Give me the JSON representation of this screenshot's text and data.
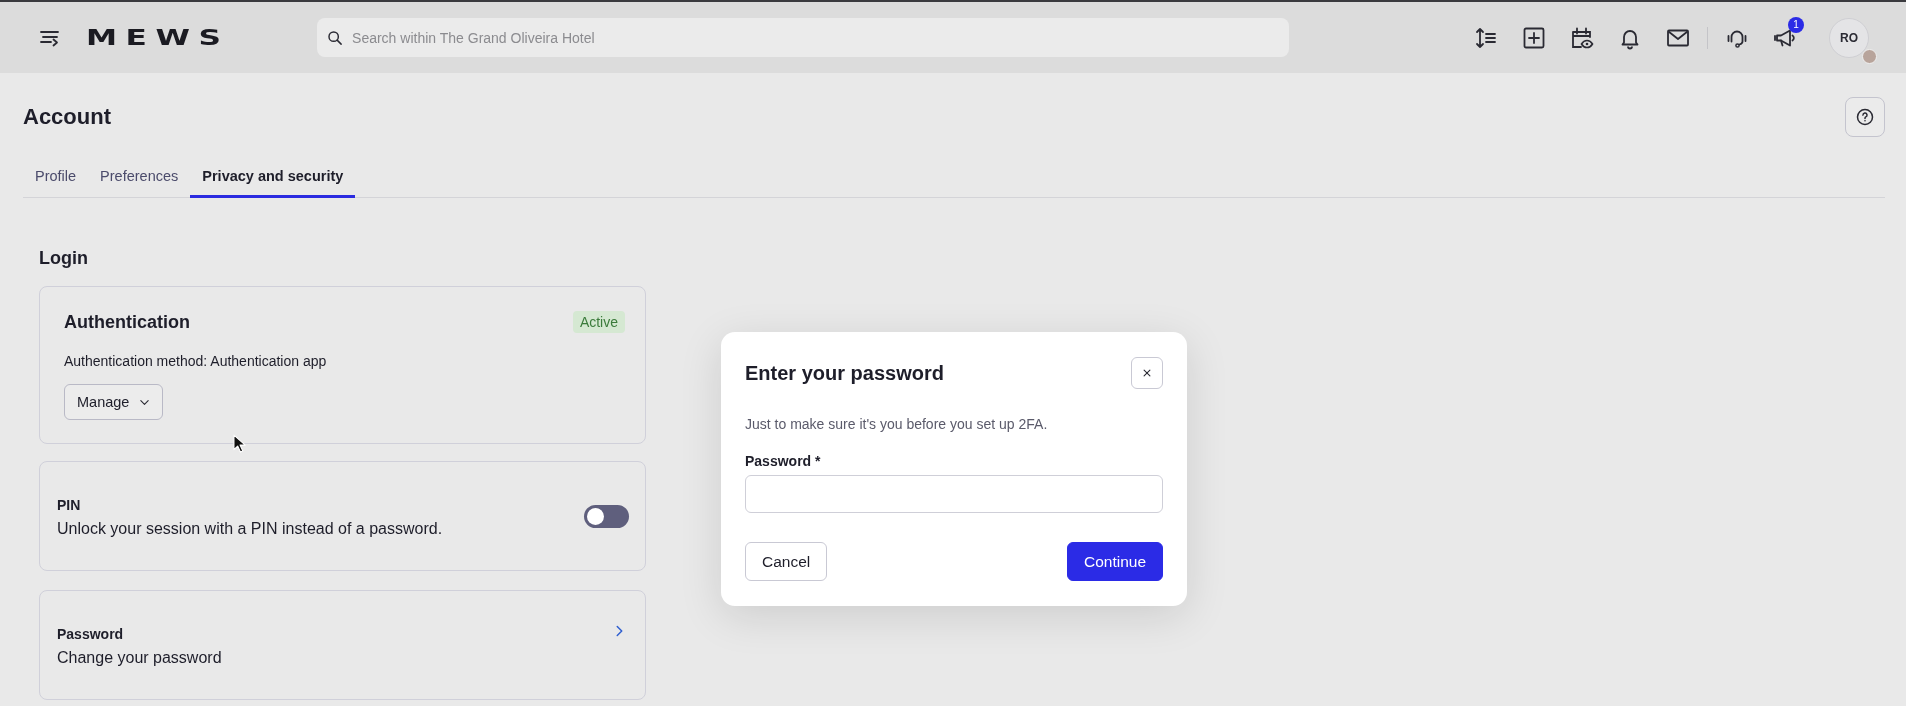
{
  "topbar": {
    "logo": "MEWS",
    "search": {
      "placeholder": "Search within The Grand Oliveira Hotel"
    },
    "notification_badge": "1",
    "avatar": {
      "initials": "RO"
    }
  },
  "page": {
    "title": "Account"
  },
  "tabs": [
    {
      "label": "Profile",
      "selected": false
    },
    {
      "label": "Preferences",
      "selected": false
    },
    {
      "label": "Privacy and security",
      "selected": true
    }
  ],
  "sections": [
    {
      "title": "Login",
      "cards": [
        {
          "kind": "status",
          "title": "Authentication",
          "status": "Active",
          "text": "Authentication method: Authentication app",
          "button": "Manage"
        },
        {
          "kind": "toggle",
          "title": "PIN",
          "text": "Unlock your session with a PIN instead of a password.",
          "on": false
        },
        {
          "kind": "link",
          "title": "Password",
          "text": "Change your password"
        }
      ]
    }
  ],
  "dialog": {
    "title": "Enter your password",
    "text": "Just to make sure it's you before you set up 2FA.",
    "field": {
      "label": "Password *"
    },
    "buttons": [
      {
        "label": "Cancel",
        "kind": "secondary"
      },
      {
        "label": "Continue",
        "kind": "primary"
      }
    ]
  }
}
